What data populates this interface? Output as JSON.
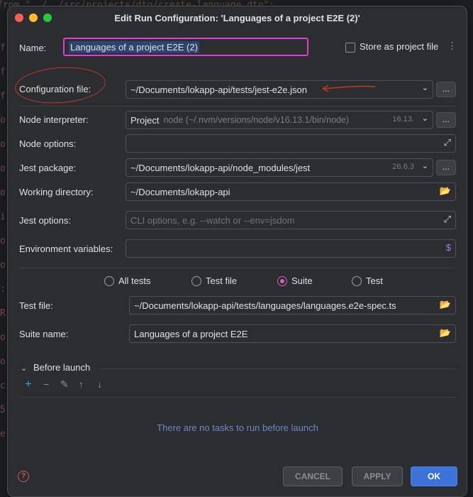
{
  "background_code": {
    "line": "from \"../../src/projects/dto/create-language.dto\";",
    "gutter_chars": [
      "f",
      "f",
      "f",
      "o",
      "o",
      "o",
      "o",
      "i",
      "o",
      "o",
      ":",
      "R",
      "o",
      "o",
      "c",
      "5",
      "e"
    ]
  },
  "window": {
    "title": "Edit Run Configuration: 'Languages of a project E2E (2)'"
  },
  "name": {
    "label": "Name:",
    "value": "Languages of a project E2E (2)"
  },
  "store_as_project_file": {
    "label": "Store as project file",
    "checked": false
  },
  "configuration_file": {
    "label": "Configuration file:",
    "value": "~/Documents/lokapp-api/tests/jest-e2e.json",
    "browse": "..."
  },
  "node_interpreter": {
    "label": "Node interpreter:",
    "value": "Project",
    "detail": "node (~/.nvm/versions/node/v16.13.1/bin/node)",
    "version": "16.13.",
    "browse": "..."
  },
  "node_options": {
    "label": "Node options:",
    "value": ""
  },
  "jest_package": {
    "label": "Jest package:",
    "value": "~/Documents/lokapp-api/node_modules/jest",
    "version": "26.6.3",
    "browse": "..."
  },
  "working_directory": {
    "label": "Working directory:",
    "value": "~/Documents/lokapp-api"
  },
  "jest_options": {
    "label": "Jest options:",
    "placeholder": "CLI options, e.g. --watch or --env=jsdom"
  },
  "environment_variables": {
    "label": "Environment variables:",
    "value": ""
  },
  "scope": {
    "options": [
      "All tests",
      "Test file",
      "Suite",
      "Test"
    ],
    "selected": "Suite"
  },
  "test_file": {
    "label": "Test file:",
    "value": "~/Documents/lokapp-api/tests/languages/languages.e2e-spec.ts"
  },
  "suite_name": {
    "label": "Suite name:",
    "value": "Languages of a project E2E"
  },
  "before_launch": {
    "title": "Before launch",
    "empty_text": "There are no tasks to run before launch",
    "tools": [
      "plus-icon",
      "minus-icon",
      "pencil-icon",
      "arrow-up-icon",
      "arrow-down-icon"
    ]
  },
  "buttons": {
    "cancel": "CANCEL",
    "apply": "APPLY",
    "ok": "OK"
  },
  "colors": {
    "accent": "#3d73d8",
    "highlight_box": "#e03dd5",
    "annotation": "#c0392b",
    "radio_selected": "#d35ec3"
  }
}
